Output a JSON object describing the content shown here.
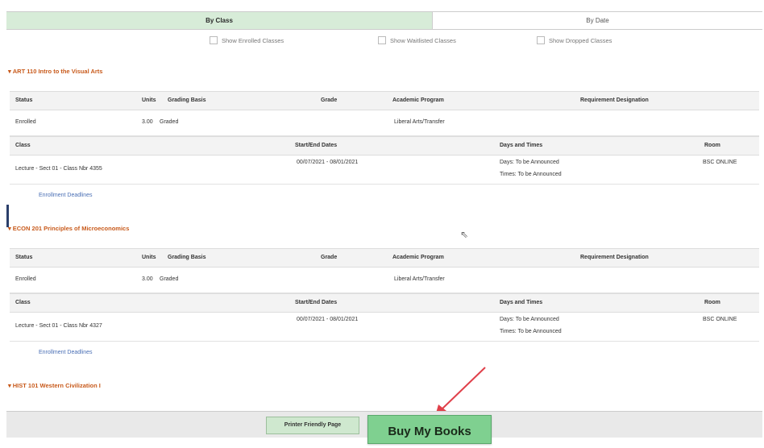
{
  "tabs": {
    "by_class": "By Class",
    "by_date": "By Date"
  },
  "filters": {
    "enrolled": "Show Enrolled Classes",
    "waitlisted": "Show Waitlisted Classes",
    "dropped": "Show Dropped Classes"
  },
  "headers": {
    "status": "Status",
    "units": "Units",
    "grading": "Grading Basis",
    "grade": "Grade",
    "program": "Academic Program",
    "requirement": "Requirement Designation",
    "class": "Class",
    "dates": "Start/End Dates",
    "days": "Days and Times",
    "room": "Room"
  },
  "courses": [
    {
      "title": "ART 110 Intro to the Visual Arts",
      "status": "Enrolled",
      "units": "3.00",
      "grading": "Graded",
      "program": "Liberal Arts/Transfer",
      "class": "Lecture - Sect 01 - Class Nbr 4355",
      "dates": "00/07/2021 - 08/01/2021",
      "days": "Days: To be Announced",
      "times": "Times: To be Announced",
      "room": "BSC ONLINE",
      "deadlines": "Enrollment Deadlines"
    },
    {
      "title": "ECON 201 Principles of Microeconomics",
      "status": "Enrolled",
      "units": "3.00",
      "grading": "Graded",
      "program": "Liberal Arts/Transfer",
      "class": "Lecture - Sect 01 - Class Nbr 4327",
      "dates": "00/07/2021 - 08/01/2021",
      "days": "Days: To be Announced",
      "times": "Times: To be Announced",
      "room": "BSC ONLINE",
      "deadlines": "Enrollment Deadlines"
    },
    {
      "title": "HIST 101 Western Civilization I"
    }
  ],
  "footer": {
    "printer": "Printer Friendly Page",
    "buy": "Buy My Books"
  },
  "colors": {
    "accent_green": "#7fd090",
    "section_orange": "#c85a1b",
    "arrow_red": "#e0404a"
  }
}
